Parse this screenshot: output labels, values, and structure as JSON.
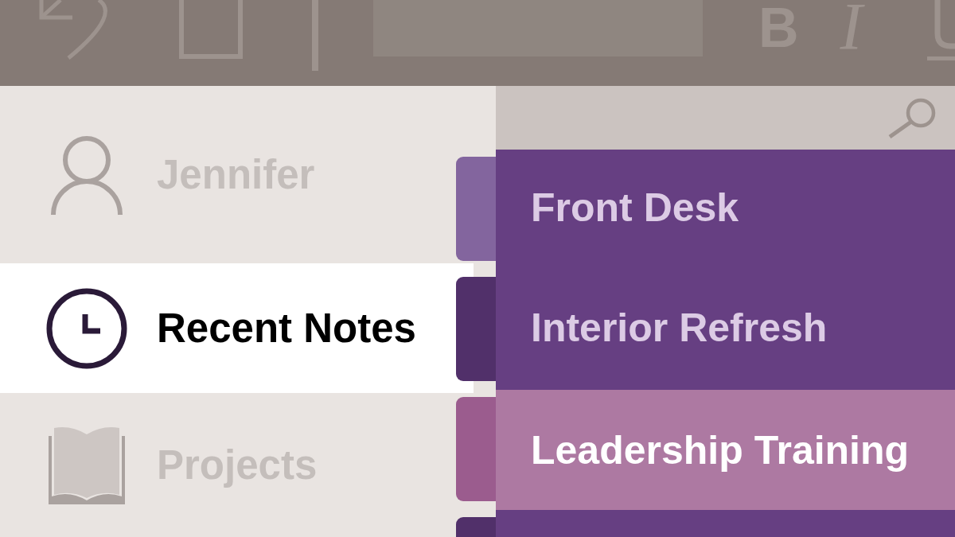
{
  "toolbar": {
    "format_buttons": [
      {
        "kind": "bold",
        "label": "B"
      },
      {
        "kind": "italic",
        "label": "I"
      },
      {
        "kind": "underline"
      }
    ]
  },
  "sidebar": {
    "items": [
      {
        "kind": "account",
        "label": "Jennifer",
        "selected": false
      },
      {
        "kind": "recent",
        "label": "Recent Notes",
        "selected": true
      },
      {
        "kind": "notebook",
        "label": "Projects",
        "selected": false
      }
    ]
  },
  "sections": [
    {
      "label": "Front Desk",
      "color": "#83659e",
      "selected": false
    },
    {
      "label": "Interior Refresh",
      "color": "#51306a",
      "selected": false
    },
    {
      "label": "Leadership Training",
      "color": "#9b5c8e",
      "selected": true
    },
    {
      "color": "#51306a",
      "selected": false
    }
  ]
}
